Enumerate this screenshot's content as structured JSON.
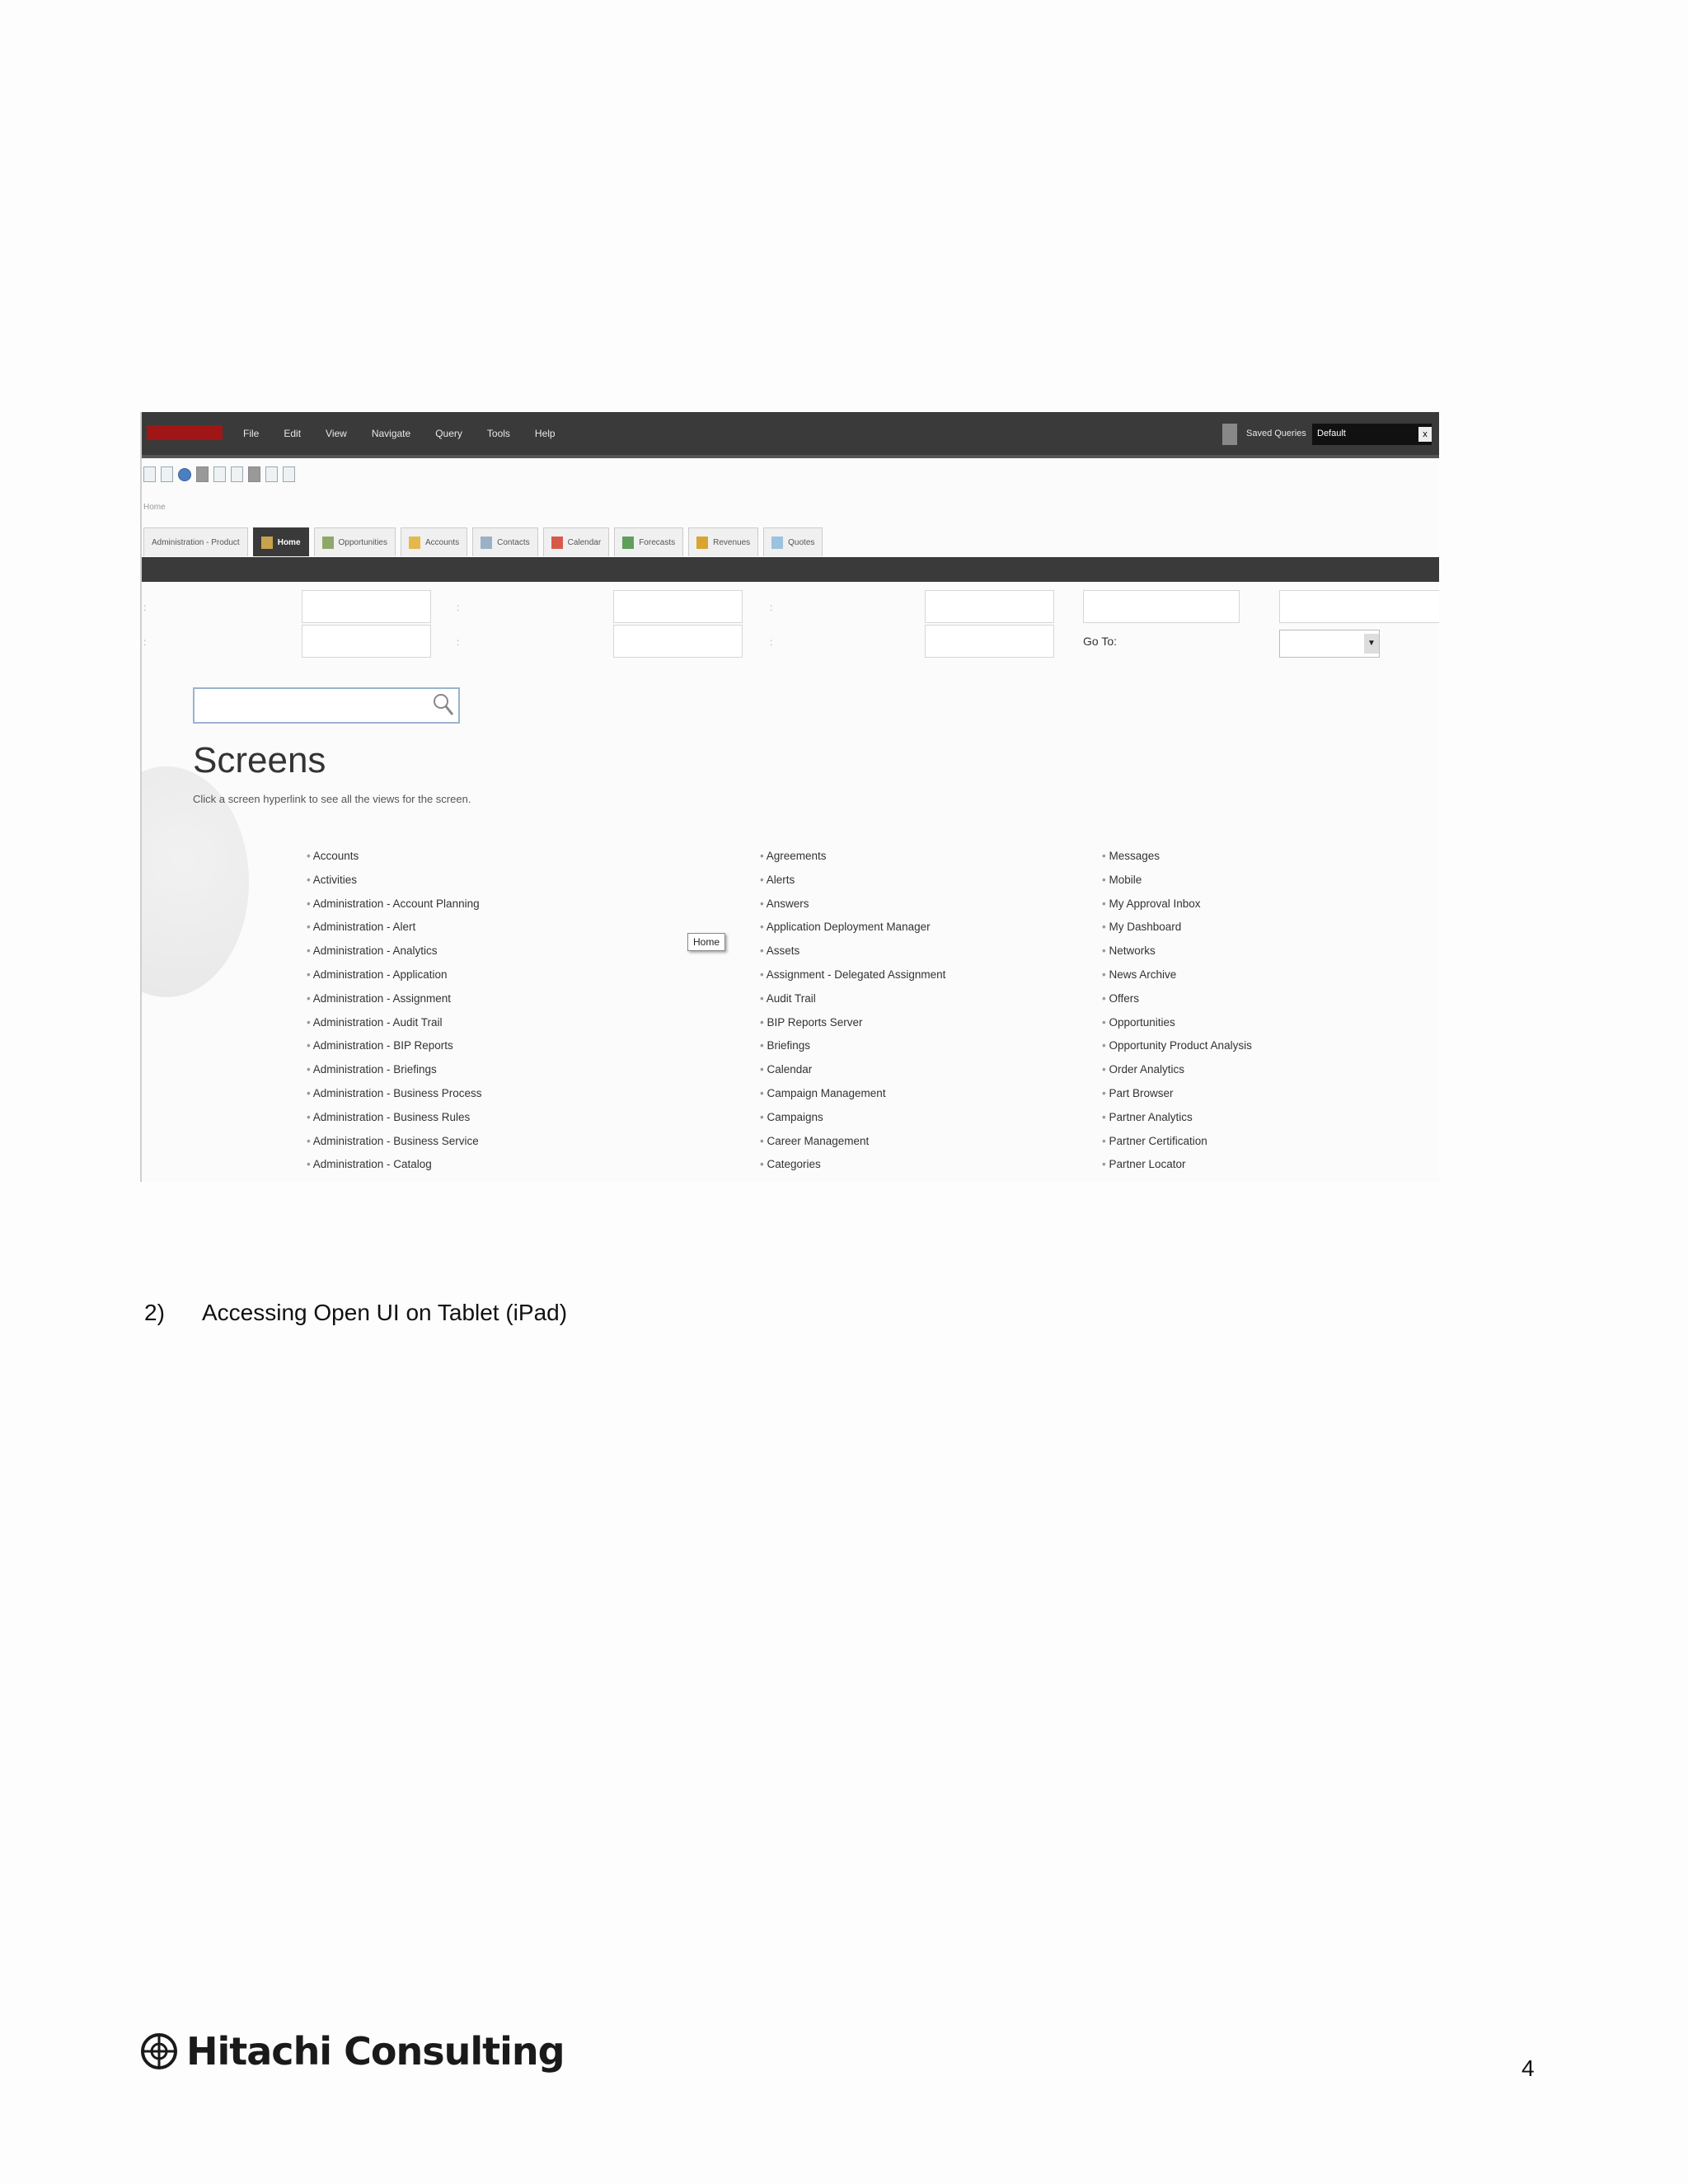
{
  "menu": [
    "File",
    "Edit",
    "View",
    "Navigate",
    "Query",
    "Tools",
    "Help"
  ],
  "saved_queries": {
    "label": "Saved Queries",
    "value": "Default",
    "close": "x"
  },
  "breadcrumb": "Home",
  "tabs": [
    "Administration - Product",
    "Home",
    "Opportunities",
    "Accounts",
    "Contacts",
    "Calendar",
    "Forecasts",
    "Revenues",
    "Quotes"
  ],
  "goto_label": "Go To:",
  "screens": {
    "title": "Screens",
    "subtitle": "Click a screen hyperlink to see all the views for the screen.",
    "col1": [
      "Accounts",
      "Activities",
      "Administration - Account Planning",
      "Administration - Alert",
      "Administration - Analytics",
      "Administration - Application",
      "Administration - Assignment",
      "Administration - Audit Trail",
      "Administration - BIP Reports",
      "Administration - Briefings",
      "Administration - Business Process",
      "Administration - Business Rules",
      "Administration - Business Service",
      "Administration - Catalog"
    ],
    "col2": [
      "Agreements",
      "Alerts",
      "Answers",
      "Application Deployment Manager",
      "Assets",
      "Assignment - Delegated Assignment",
      "Audit Trail",
      "BIP Reports Server",
      "Briefings",
      "Calendar",
      "Campaign Management",
      "Campaigns",
      "Career Management",
      "Categories"
    ],
    "col3": [
      "Messages",
      "Mobile",
      "My Approval Inbox",
      "My Dashboard",
      "Networks",
      "News Archive",
      "Offers",
      "Opportunities",
      "Opportunity Product Analysis",
      "Order Analytics",
      "Part Browser",
      "Partner Analytics",
      "Partner Certification",
      "Partner Locator"
    ]
  },
  "tooltip": "Home",
  "caption": {
    "number": "2)",
    "text": "Accessing Open UI on Tablet (iPad)"
  },
  "footer": {
    "logo": "Hitachi Consulting",
    "page": "4"
  }
}
